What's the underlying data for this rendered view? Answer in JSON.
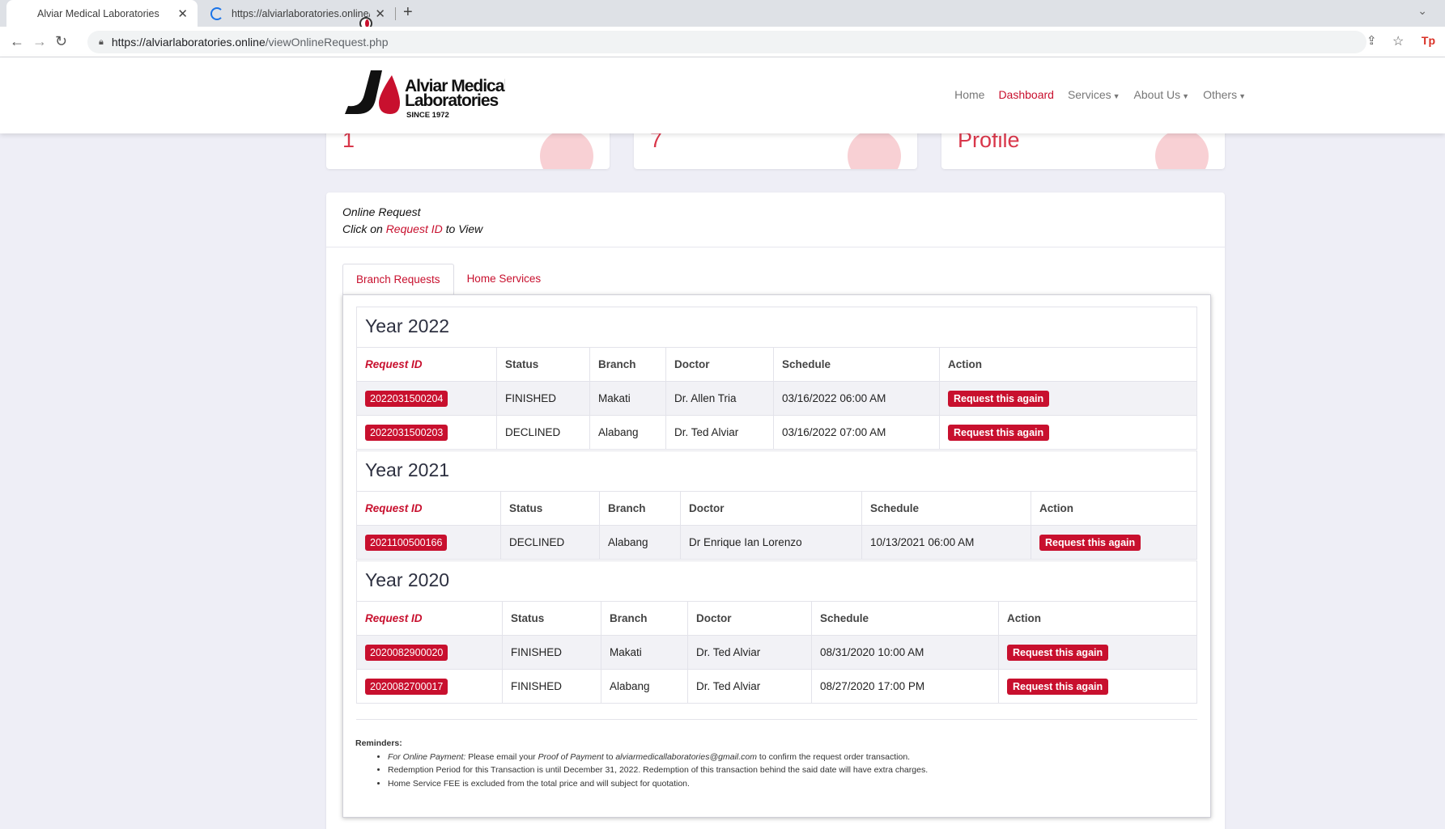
{
  "browser": {
    "tabs": [
      {
        "title": "Alviar Medical Laboratories",
        "active": true
      },
      {
        "title": "https://alviarlaboratories.online/c",
        "active": false
      }
    ],
    "new_tab": "+",
    "url_host": "https://alviarlaboratories.online",
    "url_path": "/viewOnlineRequest.php",
    "ext_label": "Tp"
  },
  "site": {
    "logo_line1": "Alviar Medical",
    "logo_line2": "Laboratories",
    "logo_line3": "SINCE 1972",
    "brand_color": "#c8102e",
    "nav": [
      {
        "label": "Home",
        "active": false,
        "dropdown": false
      },
      {
        "label": "Dashboard",
        "active": true,
        "dropdown": false
      },
      {
        "label": "Services",
        "active": false,
        "dropdown": true
      },
      {
        "label": "About Us",
        "active": false,
        "dropdown": true
      },
      {
        "label": "Others",
        "active": false,
        "dropdown": true
      }
    ]
  },
  "stat_cards": [
    {
      "value": "1"
    },
    {
      "value": "7"
    },
    {
      "value": "Profile"
    }
  ],
  "card": {
    "title": "Online Request",
    "sub_prefix": "Click on",
    "sub_link": "Request ID",
    "sub_suffix": "to View"
  },
  "tabs": [
    {
      "label": "Branch Requests",
      "active": true
    },
    {
      "label": "Home Services",
      "active": false
    }
  ],
  "columns": [
    "Request ID",
    "Status",
    "Branch",
    "Doctor",
    "Schedule",
    "Action"
  ],
  "action_label": "Request this again",
  "years": [
    {
      "title": "Year 2022",
      "rows": [
        {
          "id": "2022031500204",
          "status": "FINISHED",
          "branch": "Makati",
          "doctor": "Dr. Allen Tria",
          "schedule": "03/16/2022 06:00 AM"
        },
        {
          "id": "2022031500203",
          "status": "DECLINED",
          "branch": "Alabang",
          "doctor": "Dr. Ted Alviar",
          "schedule": "03/16/2022 07:00 AM"
        }
      ]
    },
    {
      "title": "Year 2021",
      "rows": [
        {
          "id": "2021100500166",
          "status": "DECLINED",
          "branch": "Alabang",
          "doctor": "Dr Enrique Ian Lorenzo",
          "schedule": "10/13/2021 06:00 AM"
        }
      ]
    },
    {
      "title": "Year 2020",
      "rows": [
        {
          "id": "2020082900020",
          "status": "FINISHED",
          "branch": "Makati",
          "doctor": "Dr. Ted Alviar",
          "schedule": "08/31/2020 10:00 AM"
        },
        {
          "id": "2020082700017",
          "status": "FINISHED",
          "branch": "Alabang",
          "doctor": "Dr. Ted Alviar",
          "schedule": "08/27/2020 17:00 PM"
        }
      ]
    }
  ],
  "reminders": {
    "title": "Reminders:",
    "item1_em": "For Online Payment:",
    "item1_a": "Please email your",
    "item1_em2": "Proof of Payment",
    "item1_b": "to",
    "item1_email": "alviarmedicallaboratories@gmail.com",
    "item1_c": "to confirm the request order transaction.",
    "item2": "Redemption Period for this Transaction is until December 31, 2022. Redemption of this transaction behind the said date will have extra charges.",
    "item3": "Home Service FEE is excluded from the total price and will subject for quotation."
  }
}
